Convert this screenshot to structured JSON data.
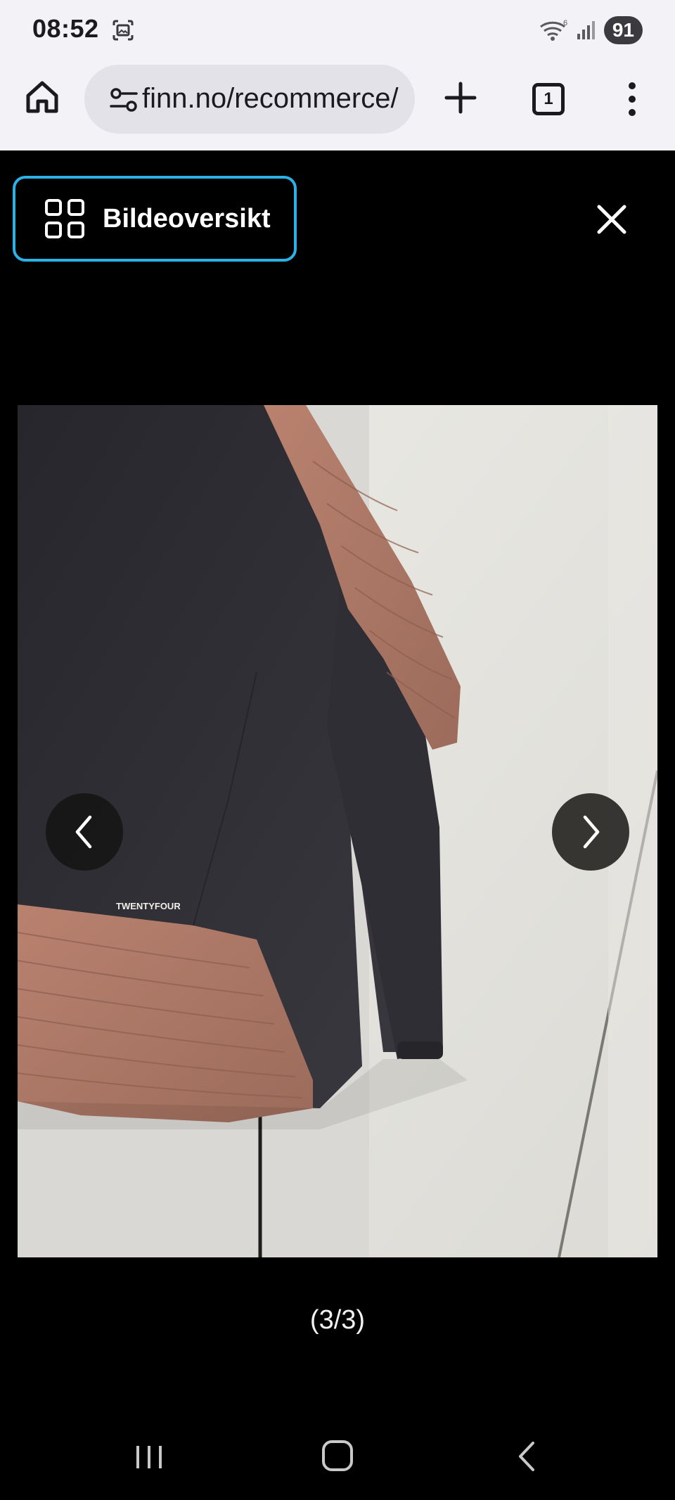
{
  "status_bar": {
    "time": "08:52",
    "battery": "91",
    "icons": [
      "screenshot-icon",
      "wifi-icon",
      "signal-icon",
      "battery-icon"
    ]
  },
  "browser": {
    "url": "finn.no/recommerce/",
    "tab_count": "1",
    "icons": [
      "home-icon",
      "site-settings-icon",
      "new-tab-icon",
      "tabs-icon",
      "more-menu-icon"
    ]
  },
  "viewer": {
    "overview_label": "Bildeoversikt",
    "counter": "(3/3)",
    "photo": {
      "brand_print": "TWENTYFOUR",
      "colors": {
        "jacket_dark": "#2e2d33",
        "jacket_panel": "#b07a68",
        "wall": "#e7e6e1"
      }
    },
    "icons": [
      "grid-icon",
      "close-icon",
      "chevron-left-icon",
      "chevron-right-icon"
    ]
  },
  "system_nav": {
    "icons": [
      "recents-icon",
      "home-circle-icon",
      "back-icon"
    ]
  },
  "colors": {
    "accent_focus": "#2bb1e8",
    "chrome_bg": "#f3f2f7",
    "url_bg": "#e3e2e8"
  }
}
